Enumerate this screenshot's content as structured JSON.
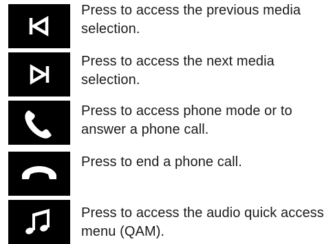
{
  "items": [
    {
      "icon": "skip-previous-icon",
      "description": "Press to access the previous media selection."
    },
    {
      "icon": "skip-next-icon",
      "description": "Press to access the next media selection."
    },
    {
      "icon": "phone-icon",
      "description": "Press to access phone mode or to answer a phone call."
    },
    {
      "icon": "end-call-icon",
      "description": "Press to end a phone call."
    },
    {
      "icon": "music-note-icon",
      "description": "Press to access the audio quick access menu (QAM)."
    }
  ]
}
